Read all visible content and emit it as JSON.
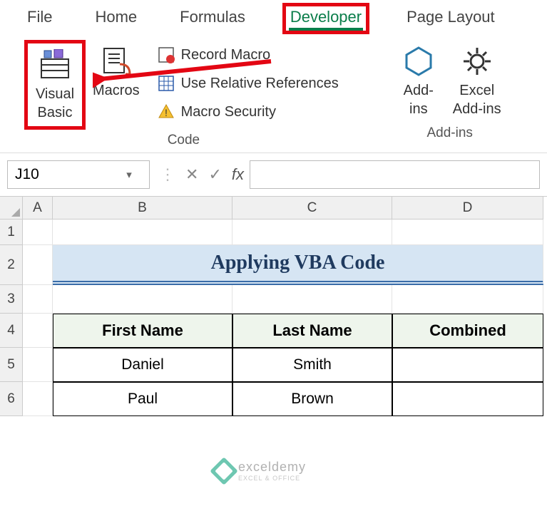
{
  "tabs": {
    "file": "File",
    "home": "Home",
    "formulas": "Formulas",
    "developer": "Developer",
    "page_layout": "Page Layout"
  },
  "ribbon": {
    "visual_basic": "Visual\nBasic",
    "macros": "Macros",
    "record_macro": "Record Macro",
    "use_relative": "Use Relative References",
    "macro_security": "Macro Security",
    "code_label": "Code",
    "addins": "Add-\nins",
    "excel_addins": "Excel\nAdd-ins",
    "addins_label": "Add-ins"
  },
  "namebox": {
    "value": "J10"
  },
  "columns": {
    "a": "A",
    "b": "B",
    "c": "C",
    "d": "D"
  },
  "rows": {
    "r1": "1",
    "r2": "2",
    "r3": "3",
    "r4": "4",
    "r5": "5",
    "r6": "6"
  },
  "sheet": {
    "title": "Applying VBA Code",
    "headers": {
      "first": "First Name",
      "last": "Last Name",
      "combined": "Combined"
    },
    "data": [
      {
        "first": "Daniel",
        "last": "Smith",
        "combined": ""
      },
      {
        "first": "Paul",
        "last": "Brown",
        "combined": ""
      }
    ]
  },
  "watermark": {
    "text": "exceldemy",
    "sub": "EXCEL & OFFICE"
  },
  "col_widths": {
    "a": 42,
    "b": 252,
    "c": 224,
    "d": 212
  },
  "row_heights": {
    "header": 32,
    "r1": 36,
    "r2": 56,
    "r3": 40,
    "r4": 48,
    "r5": 48,
    "r6": 48
  }
}
